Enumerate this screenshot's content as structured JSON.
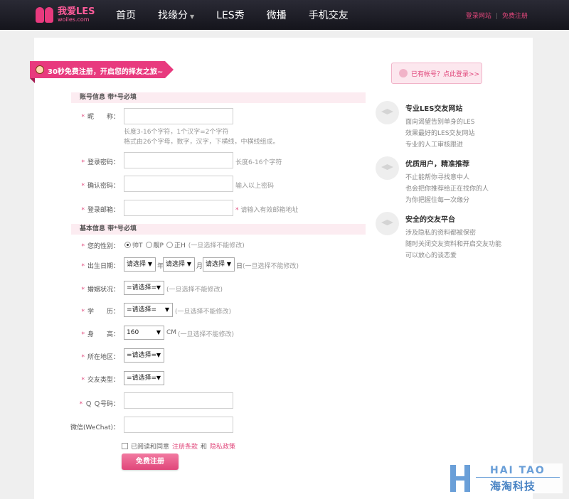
{
  "header": {
    "logo_cn": "我爱LES",
    "logo_url": "woiles.com",
    "nav": [
      {
        "label": "首页"
      },
      {
        "label": "找缘分"
      },
      {
        "label": "LES秀"
      },
      {
        "label": "微播"
      },
      {
        "label": "手机交友"
      }
    ],
    "login_link": "登录网站",
    "register_link": "免费注册"
  },
  "banner": {
    "ribbon_text": "30秒免费注册，开启您的择友之旅~",
    "login_prompt": "已有帐号？点此登录>>"
  },
  "account_section": {
    "heading": "账号信息 带*号必填",
    "nickname_label": "昵　　称：",
    "nickname_hint1": "长度3-16个字符，1个汉字=2个字符",
    "nickname_hint2": "格式由26个字母，数字，汉字，下横线，中横线组成。",
    "password_label": "登录密码：",
    "password_hint": "长度6-16个字符",
    "confirm_label": "确认密码：",
    "confirm_hint": "输入以上密码",
    "email_label": "登录邮箱：",
    "email_hint": "请输入有效邮箱地址"
  },
  "basic_section": {
    "heading": "基本信息 带*号必填",
    "gender_label": "您的性别：",
    "gender_options": [
      "帅T",
      "靓P",
      "正H"
    ],
    "gender_selected": 0,
    "gender_note": "(一旦选择不能修改)",
    "birth_label": "出生日期：",
    "birth_year": "请选择",
    "birth_month": "请选择",
    "birth_day": "请选择",
    "year_unit": "年",
    "month_unit": "月",
    "day_unit": "日",
    "birth_note": "(一旦选择不能修改)",
    "marital_label": "婚姻状况：",
    "marital_value": "=请选择=",
    "marital_note": "(一旦选择不能修改)",
    "education_label": "学　　历：",
    "education_value": "=请选择=",
    "education_note": "(一旦选择不能修改)",
    "height_label": "身　　高：",
    "height_value": "160",
    "height_unit": "CM",
    "height_note": "(一旦选择不能修改)",
    "region_label": "所在地区：",
    "region_value": "=请选择=",
    "dating_label": "交友类型：",
    "dating_value": "=请选择=",
    "qq_label": "Ｑ Ｑ号码：",
    "wechat_label": "微信(WeChat)：",
    "agree_text": "已阅读和同意",
    "terms_link": "注册条款",
    "and_text": "和",
    "privacy_link": "隐私政策",
    "submit_label": "免费注册"
  },
  "features": [
    {
      "title": "专业LES交友网站",
      "lines": [
        "面向渴望告别单身的LES",
        "效果最好的LES交友网站",
        "专业的人工审核跟进"
      ]
    },
    {
      "title": "优质用户，精准推荐",
      "lines": [
        "不止能帮你寻找意中人",
        "也会把你推荐给正在找你的人",
        "为你把握住每一次缘分"
      ]
    },
    {
      "title": "安全的交友平台",
      "lines": [
        "涉及隐私的资料都被保密",
        "随时关闭交友资料和开启交友功能",
        "可以放心的谈恋爱"
      ]
    }
  ],
  "watermark": {
    "en": "HAI TAO",
    "cn": "海淘科技"
  }
}
